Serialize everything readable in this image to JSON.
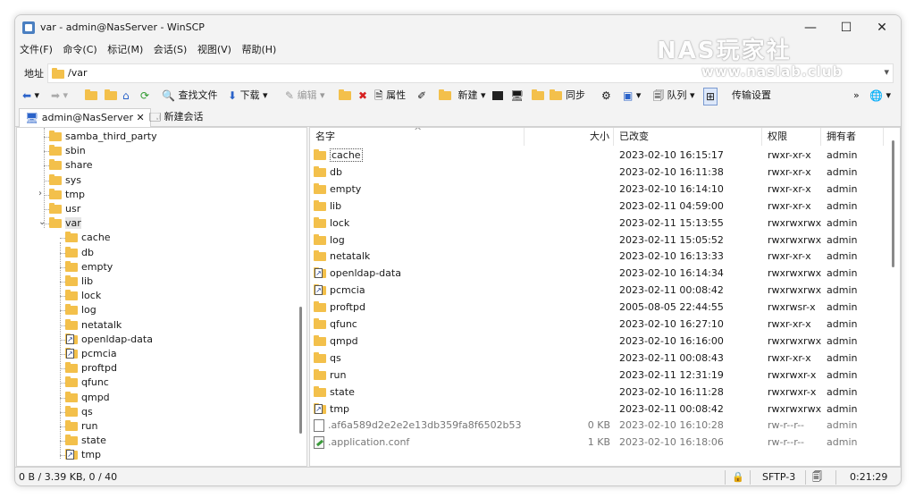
{
  "window": {
    "title": "var - admin@NasServer - WinSCP"
  },
  "menu": [
    "文件(F)",
    "命令(C)",
    "标记(M)",
    "会话(S)",
    "视图(V)",
    "帮助(H)"
  ],
  "address": {
    "label": "地址",
    "path": "/var"
  },
  "toolbar": {
    "find_files": "查找文件",
    "download": "下载",
    "edit": "编辑",
    "properties": "属性",
    "new": "新建",
    "sync": "同步",
    "queue": "队列",
    "transfer_settings": "传输设置"
  },
  "tabs": [
    {
      "label": "admin@NasServer",
      "close": "✕"
    },
    {
      "label": "新建会话"
    }
  ],
  "tree": {
    "top_items": [
      "samba_third_party",
      "sbin",
      "share",
      "sys",
      "tmp",
      "usr",
      "var"
    ],
    "var_children": [
      "cache",
      "db",
      "empty",
      "lib",
      "lock",
      "log",
      "netatalk",
      "openldap-data",
      "pcmcia",
      "proftpd",
      "qfunc",
      "qmpd",
      "qs",
      "run",
      "state",
      "tmp"
    ],
    "linked_children": [
      "openldap-data",
      "pcmcia",
      "tmp"
    ]
  },
  "files": {
    "headers": {
      "name": "名字",
      "size": "大小",
      "changed": "已改变",
      "rights": "权限",
      "owner": "拥有者"
    },
    "rows": [
      {
        "name": "cache",
        "size": "",
        "changed": "2023-02-10 16:15:17",
        "rights": "rwxr-xr-x",
        "owner": "admin",
        "type": "folder"
      },
      {
        "name": "db",
        "size": "",
        "changed": "2023-02-10 16:11:38",
        "rights": "rwxr-xr-x",
        "owner": "admin",
        "type": "folder"
      },
      {
        "name": "empty",
        "size": "",
        "changed": "2023-02-10 16:14:10",
        "rights": "rwxr-xr-x",
        "owner": "admin",
        "type": "folder"
      },
      {
        "name": "lib",
        "size": "",
        "changed": "2023-02-11 04:59:00",
        "rights": "rwxr-xr-x",
        "owner": "admin",
        "type": "folder"
      },
      {
        "name": "lock",
        "size": "",
        "changed": "2023-02-11 15:13:55",
        "rights": "rwxrwxrwx",
        "owner": "admin",
        "type": "folder"
      },
      {
        "name": "log",
        "size": "",
        "changed": "2023-02-11 15:05:52",
        "rights": "rwxrwxrwx",
        "owner": "admin",
        "type": "folder"
      },
      {
        "name": "netatalk",
        "size": "",
        "changed": "2023-02-10 16:13:33",
        "rights": "rwxr-xr-x",
        "owner": "admin",
        "type": "folder"
      },
      {
        "name": "openldap-data",
        "size": "",
        "changed": "2023-02-10 16:14:34",
        "rights": "rwxrwxrwx",
        "owner": "admin",
        "type": "link"
      },
      {
        "name": "pcmcia",
        "size": "",
        "changed": "2023-02-11 00:08:42",
        "rights": "rwxrwxrwx",
        "owner": "admin",
        "type": "link"
      },
      {
        "name": "proftpd",
        "size": "",
        "changed": "2005-08-05 22:44:55",
        "rights": "rwxrwsr-x",
        "owner": "admin",
        "type": "folder"
      },
      {
        "name": "qfunc",
        "size": "",
        "changed": "2023-02-10 16:27:10",
        "rights": "rwxr-xr-x",
        "owner": "admin",
        "type": "folder"
      },
      {
        "name": "qmpd",
        "size": "",
        "changed": "2023-02-10 16:16:00",
        "rights": "rwxrwxrwx",
        "owner": "admin",
        "type": "folder"
      },
      {
        "name": "qs",
        "size": "",
        "changed": "2023-02-11 00:08:43",
        "rights": "rwxr-xr-x",
        "owner": "admin",
        "type": "folder"
      },
      {
        "name": "run",
        "size": "",
        "changed": "2023-02-11 12:31:19",
        "rights": "rwxrwxr-x",
        "owner": "admin",
        "type": "folder"
      },
      {
        "name": "state",
        "size": "",
        "changed": "2023-02-10 16:11:28",
        "rights": "rwxrwxr-x",
        "owner": "admin",
        "type": "folder"
      },
      {
        "name": "tmp",
        "size": "",
        "changed": "2023-02-11 00:08:42",
        "rights": "rwxrwxrwx",
        "owner": "admin",
        "type": "link"
      },
      {
        "name": ".af6a589d2e2e2e13db359fa8f6502b53",
        "size": "0 KB",
        "changed": "2023-02-10 16:10:28",
        "rights": "rw-r--r--",
        "owner": "admin",
        "type": "file"
      },
      {
        "name": ".application.conf",
        "size": "1 KB",
        "changed": "2023-02-10 16:18:06",
        "rights": "rw-r--r--",
        "owner": "admin",
        "type": "conf"
      }
    ]
  },
  "status": {
    "selection": "0 B / 3.39 KB,  0 / 40",
    "protocol": "SFTP-3",
    "elapsed": "0:21:29"
  },
  "watermark": {
    "logo": "NAS玩家社",
    "url": "www.naslab.club"
  }
}
